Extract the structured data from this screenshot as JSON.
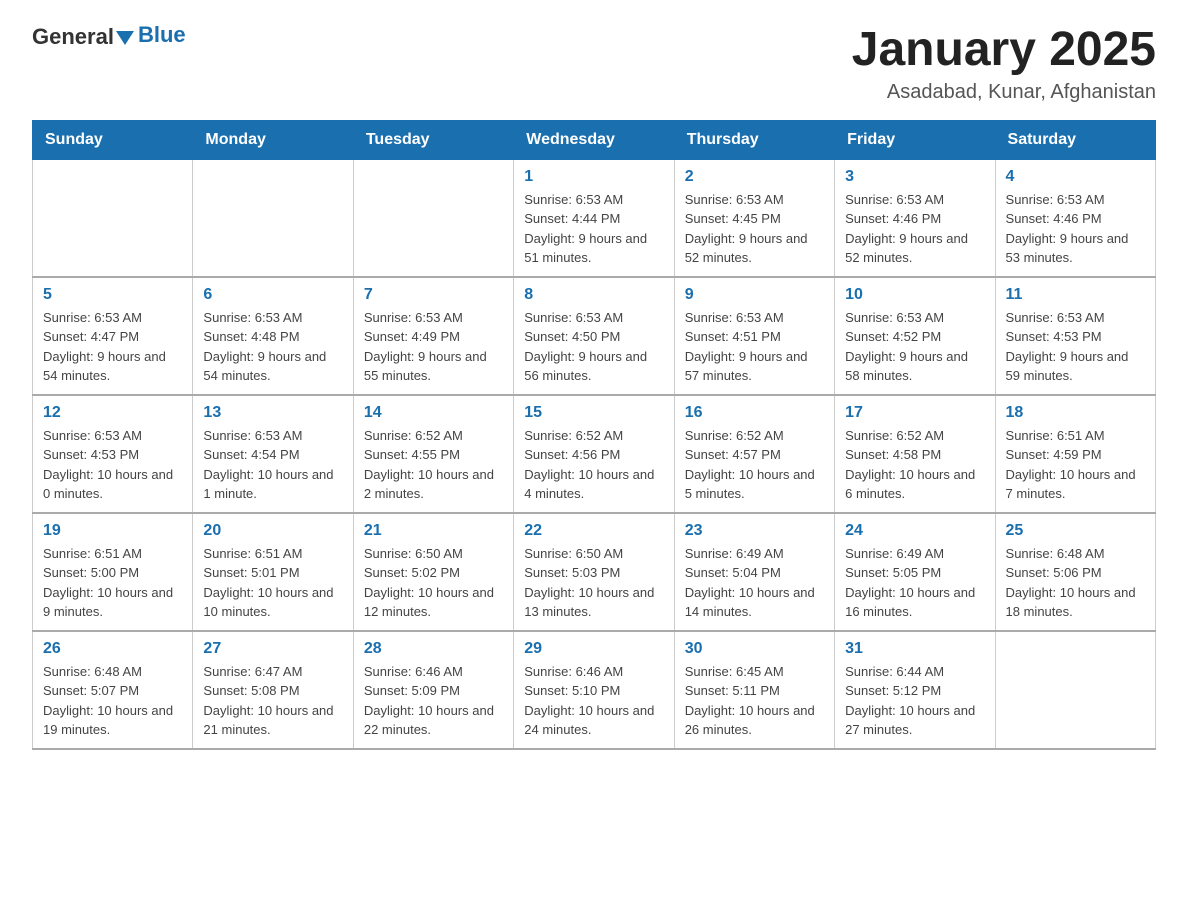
{
  "header": {
    "logo_general": "General",
    "logo_blue": "Blue",
    "title": "January 2025",
    "subtitle": "Asadabad, Kunar, Afghanistan"
  },
  "columns": [
    "Sunday",
    "Monday",
    "Tuesday",
    "Wednesday",
    "Thursday",
    "Friday",
    "Saturday"
  ],
  "weeks": [
    [
      {
        "day": "",
        "info": ""
      },
      {
        "day": "",
        "info": ""
      },
      {
        "day": "",
        "info": ""
      },
      {
        "day": "1",
        "info": "Sunrise: 6:53 AM\nSunset: 4:44 PM\nDaylight: 9 hours and 51 minutes."
      },
      {
        "day": "2",
        "info": "Sunrise: 6:53 AM\nSunset: 4:45 PM\nDaylight: 9 hours and 52 minutes."
      },
      {
        "day": "3",
        "info": "Sunrise: 6:53 AM\nSunset: 4:46 PM\nDaylight: 9 hours and 52 minutes."
      },
      {
        "day": "4",
        "info": "Sunrise: 6:53 AM\nSunset: 4:46 PM\nDaylight: 9 hours and 53 minutes."
      }
    ],
    [
      {
        "day": "5",
        "info": "Sunrise: 6:53 AM\nSunset: 4:47 PM\nDaylight: 9 hours and 54 minutes."
      },
      {
        "day": "6",
        "info": "Sunrise: 6:53 AM\nSunset: 4:48 PM\nDaylight: 9 hours and 54 minutes."
      },
      {
        "day": "7",
        "info": "Sunrise: 6:53 AM\nSunset: 4:49 PM\nDaylight: 9 hours and 55 minutes."
      },
      {
        "day": "8",
        "info": "Sunrise: 6:53 AM\nSunset: 4:50 PM\nDaylight: 9 hours and 56 minutes."
      },
      {
        "day": "9",
        "info": "Sunrise: 6:53 AM\nSunset: 4:51 PM\nDaylight: 9 hours and 57 minutes."
      },
      {
        "day": "10",
        "info": "Sunrise: 6:53 AM\nSunset: 4:52 PM\nDaylight: 9 hours and 58 minutes."
      },
      {
        "day": "11",
        "info": "Sunrise: 6:53 AM\nSunset: 4:53 PM\nDaylight: 9 hours and 59 minutes."
      }
    ],
    [
      {
        "day": "12",
        "info": "Sunrise: 6:53 AM\nSunset: 4:53 PM\nDaylight: 10 hours and 0 minutes."
      },
      {
        "day": "13",
        "info": "Sunrise: 6:53 AM\nSunset: 4:54 PM\nDaylight: 10 hours and 1 minute."
      },
      {
        "day": "14",
        "info": "Sunrise: 6:52 AM\nSunset: 4:55 PM\nDaylight: 10 hours and 2 minutes."
      },
      {
        "day": "15",
        "info": "Sunrise: 6:52 AM\nSunset: 4:56 PM\nDaylight: 10 hours and 4 minutes."
      },
      {
        "day": "16",
        "info": "Sunrise: 6:52 AM\nSunset: 4:57 PM\nDaylight: 10 hours and 5 minutes."
      },
      {
        "day": "17",
        "info": "Sunrise: 6:52 AM\nSunset: 4:58 PM\nDaylight: 10 hours and 6 minutes."
      },
      {
        "day": "18",
        "info": "Sunrise: 6:51 AM\nSunset: 4:59 PM\nDaylight: 10 hours and 7 minutes."
      }
    ],
    [
      {
        "day": "19",
        "info": "Sunrise: 6:51 AM\nSunset: 5:00 PM\nDaylight: 10 hours and 9 minutes."
      },
      {
        "day": "20",
        "info": "Sunrise: 6:51 AM\nSunset: 5:01 PM\nDaylight: 10 hours and 10 minutes."
      },
      {
        "day": "21",
        "info": "Sunrise: 6:50 AM\nSunset: 5:02 PM\nDaylight: 10 hours and 12 minutes."
      },
      {
        "day": "22",
        "info": "Sunrise: 6:50 AM\nSunset: 5:03 PM\nDaylight: 10 hours and 13 minutes."
      },
      {
        "day": "23",
        "info": "Sunrise: 6:49 AM\nSunset: 5:04 PM\nDaylight: 10 hours and 14 minutes."
      },
      {
        "day": "24",
        "info": "Sunrise: 6:49 AM\nSunset: 5:05 PM\nDaylight: 10 hours and 16 minutes."
      },
      {
        "day": "25",
        "info": "Sunrise: 6:48 AM\nSunset: 5:06 PM\nDaylight: 10 hours and 18 minutes."
      }
    ],
    [
      {
        "day": "26",
        "info": "Sunrise: 6:48 AM\nSunset: 5:07 PM\nDaylight: 10 hours and 19 minutes."
      },
      {
        "day": "27",
        "info": "Sunrise: 6:47 AM\nSunset: 5:08 PM\nDaylight: 10 hours and 21 minutes."
      },
      {
        "day": "28",
        "info": "Sunrise: 6:46 AM\nSunset: 5:09 PM\nDaylight: 10 hours and 22 minutes."
      },
      {
        "day": "29",
        "info": "Sunrise: 6:46 AM\nSunset: 5:10 PM\nDaylight: 10 hours and 24 minutes."
      },
      {
        "day": "30",
        "info": "Sunrise: 6:45 AM\nSunset: 5:11 PM\nDaylight: 10 hours and 26 minutes."
      },
      {
        "day": "31",
        "info": "Sunrise: 6:44 AM\nSunset: 5:12 PM\nDaylight: 10 hours and 27 minutes."
      },
      {
        "day": "",
        "info": ""
      }
    ]
  ]
}
